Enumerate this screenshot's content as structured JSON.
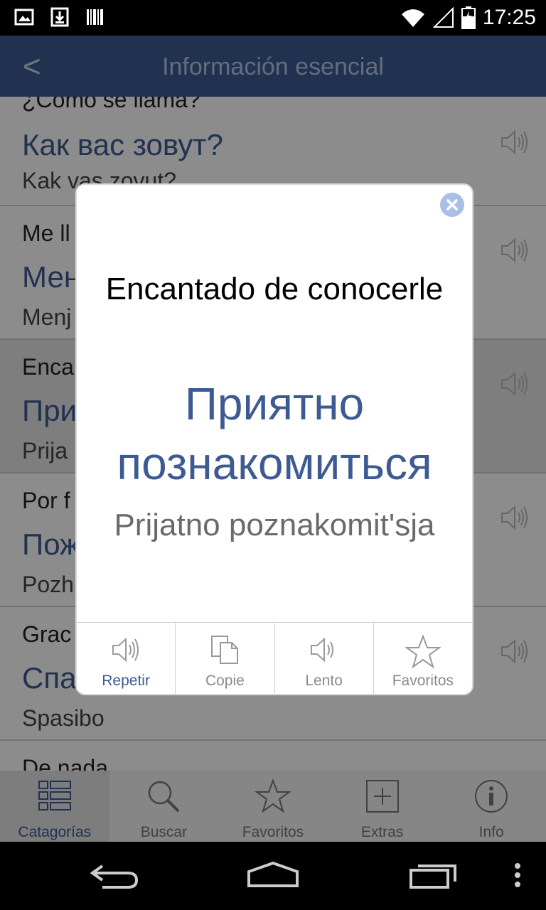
{
  "status_bar": {
    "time": "17:25"
  },
  "app_bar": {
    "back_label": "<",
    "title": "Información esencial"
  },
  "phrases": [
    {
      "src": "¿Como se llama?",
      "rus": "Как вас зовут?",
      "lat": "Kak vas zovut?"
    },
    {
      "src": "Me ll",
      "rus": "Мен",
      "lat": "Menj"
    },
    {
      "src": "Enca",
      "rus": "При",
      "lat": "Prija"
    },
    {
      "src": "Por f",
      "rus": "Пож",
      "lat": "Pozh"
    },
    {
      "src": "Grac",
      "rus": "Спа",
      "lat": "Spasibo"
    },
    {
      "src": "De nada",
      "rus": "",
      "lat": ""
    }
  ],
  "dialog": {
    "source_text": "Encantado de conocerle",
    "russian_text": "Приятно познакомиться",
    "transliteration": "Prijatno poznakomit'sja",
    "actions": [
      {
        "label": "Repetir",
        "icon": "speaker-icon"
      },
      {
        "label": "Copie",
        "icon": "copy-icon"
      },
      {
        "label": "Lento",
        "icon": "speaker-icon"
      },
      {
        "label": "Favoritos",
        "icon": "star-icon"
      }
    ]
  },
  "tabs": [
    {
      "label": "Catagorías",
      "icon": "categories-icon"
    },
    {
      "label": "Buscar",
      "icon": "search-icon"
    },
    {
      "label": "Favoritos",
      "icon": "star-icon"
    },
    {
      "label": "Extras",
      "icon": "plus-box-icon"
    },
    {
      "label": "Info",
      "icon": "info-icon"
    }
  ],
  "colors": {
    "brand": "#3d5b92",
    "dialog_accent": "#3d5b92"
  }
}
